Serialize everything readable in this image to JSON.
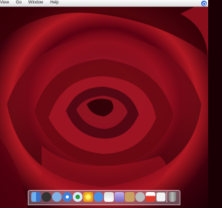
{
  "menubar": {
    "items": [
      "View",
      "Go",
      "Window",
      "Help"
    ]
  },
  "dock": {
    "apps": [
      {
        "name": "finder-icon",
        "color": "#4f8fe0"
      },
      {
        "name": "dashboard-icon",
        "color": "#3a3a3a"
      },
      {
        "name": "mail-icon",
        "color": "#6aa0d8"
      },
      {
        "name": "safari-icon",
        "color": "#3d7fd8"
      },
      {
        "name": "itunes-icon",
        "color": "#bfe0ff"
      },
      {
        "name": "iphoto-icon",
        "color": "#f2b51c"
      },
      {
        "name": "ichat-icon",
        "color": "#4a90e2"
      },
      {
        "name": "ical-icon",
        "color": "#e8e8f0"
      },
      {
        "name": "imovie-icon",
        "color": "#9a86d6"
      },
      {
        "name": "addressbook-icon",
        "color": "#c8a060"
      },
      {
        "name": "sherlock-icon",
        "color": "#d0d0d0"
      },
      {
        "name": "textedit-icon",
        "color": "#e23a2a"
      },
      {
        "name": "preview-icon",
        "color": "#f5f5f5"
      },
      {
        "name": "trash-icon",
        "color": "#8a8a8a"
      }
    ]
  },
  "colors": {
    "wallpaper": "#8c0a1c",
    "menubar": "#e8e8e8"
  }
}
